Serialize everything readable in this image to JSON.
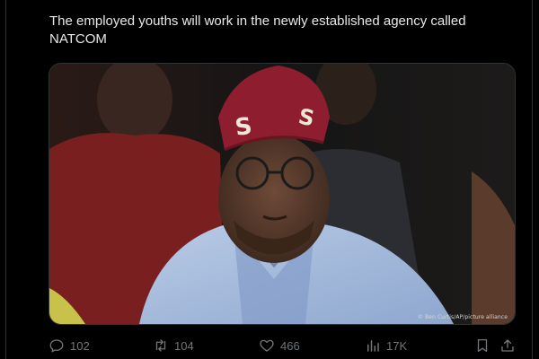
{
  "tweet": {
    "text": "The employed youths will work in the newly established agency called\nNATCOM"
  },
  "media": {
    "credit": "© Ben Curtis/AP/picture alliance"
  },
  "actions": {
    "reply_count": "102",
    "retweet_count": "104",
    "like_count": "466",
    "views_count": "17K"
  },
  "icons": {
    "reply": "reply-icon",
    "retweet": "retweet-icon",
    "like": "heart-icon",
    "views": "views-icon",
    "bookmark": "bookmark-icon",
    "share": "share-icon"
  },
  "colors": {
    "background": "#000000",
    "text": "#e7e9ea",
    "muted": "#71767b",
    "border": "#2f3336"
  }
}
